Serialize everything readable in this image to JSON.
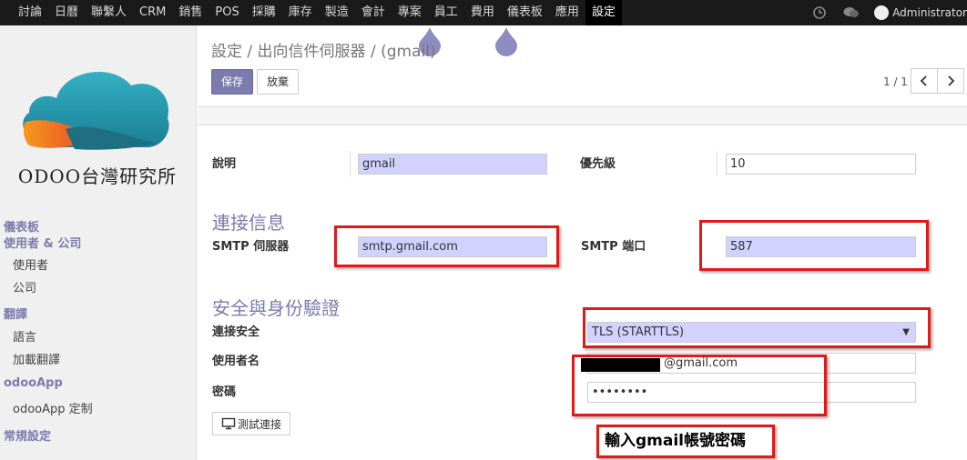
{
  "topbar": {
    "menu": [
      "討論",
      "日曆",
      "聯繫人",
      "CRM",
      "銷售",
      "POS",
      "採購",
      "庫存",
      "製造",
      "會計",
      "專案",
      "員工",
      "費用",
      "儀表板",
      "應用",
      "設定"
    ],
    "active": "設定",
    "user": "Administrator",
    "icons": [
      "clock-icon",
      "chat-icon"
    ]
  },
  "sidebar": {
    "logo_text": "ODOO台灣研究所",
    "sections": [
      {
        "label": "儀表板"
      },
      {
        "label": "使用者 & 公司",
        "items": [
          "使用者",
          "公司"
        ]
      },
      {
        "label": "翻譯",
        "items": [
          "語言",
          "加載翻譯"
        ]
      },
      {
        "label": "odooApp",
        "items": [
          "odooApp 定制"
        ]
      },
      {
        "label": "常規設定"
      }
    ]
  },
  "breadcrumb": {
    "parts": [
      "設定",
      "出向信件伺服器"
    ],
    "current": "(gmail)"
  },
  "buttons": {
    "save": "保存",
    "discard": "放棄",
    "test": "測試連接"
  },
  "pager": {
    "text": "1 / 1"
  },
  "form": {
    "description": {
      "label": "說明",
      "value": "gmail"
    },
    "priority": {
      "label": "優先級",
      "value": "10"
    },
    "connection_section": "連接信息",
    "smtp_server": {
      "label": "SMTP 伺服器",
      "value": "smtp.gmail.com"
    },
    "smtp_port": {
      "label": "SMTP 端口",
      "value": "587"
    },
    "security_section": "安全與身份驗證",
    "connection_security": {
      "label": "連接安全",
      "value": "TLS (STARTTLS)"
    },
    "username": {
      "label": "使用者名",
      "value": "@gmail.com"
    },
    "password": {
      "label": "密碼",
      "value": "••••••••"
    }
  },
  "annotation": {
    "callout": "輸入gmail帳號密碼"
  },
  "colors": {
    "accent": "#7c7bad",
    "required_field": "#d2d2ff",
    "annotation_red": "#e01919",
    "topbar": "#1a1a1a"
  }
}
